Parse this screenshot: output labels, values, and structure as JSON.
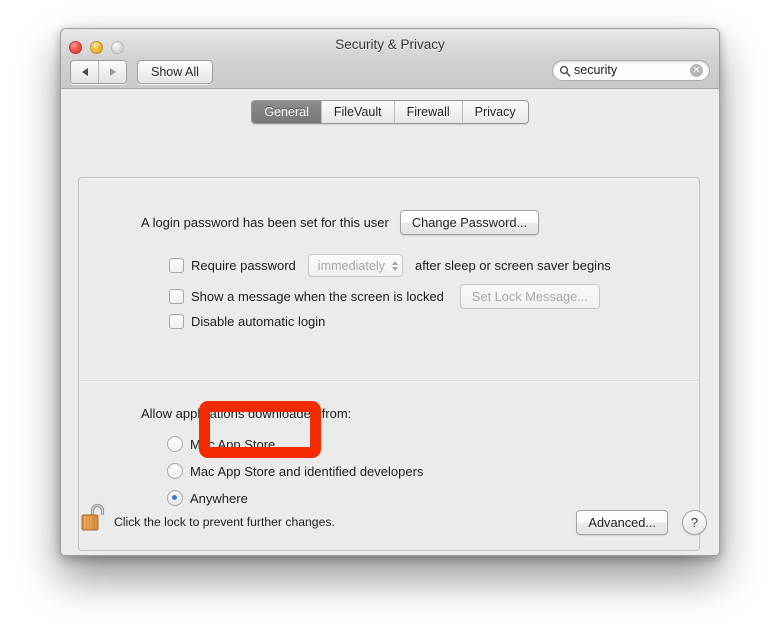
{
  "window": {
    "title": "Security & Privacy",
    "traffic_lights": [
      "close",
      "minimize",
      "zoom"
    ],
    "back_label": "back-arrow",
    "forward_label": "forward-arrow",
    "show_all_label": "Show All"
  },
  "search": {
    "value": "security",
    "icon": "search-icon",
    "clear_glyph": "✕"
  },
  "tabs": [
    {
      "label": "General",
      "active": true
    },
    {
      "label": "FileVault",
      "active": false
    },
    {
      "label": "Firewall",
      "active": false
    },
    {
      "label": "Privacy",
      "active": false
    }
  ],
  "general": {
    "password_status": "A login password has been set for this user",
    "change_password_button": "Change Password...",
    "checkboxes": [
      {
        "label": "Require password",
        "checked": false,
        "popup_value": "immediately",
        "popup_disabled": true,
        "suffix": "after sleep or screen saver begins"
      },
      {
        "label": "Show a message when the screen is locked",
        "checked": false,
        "button": "Set Lock Message...",
        "button_disabled": true
      },
      {
        "label": "Disable automatic login",
        "checked": false
      }
    ],
    "allow_label": "Allow applications downloaded from:",
    "radios": [
      {
        "label": "Mac App Store",
        "selected": false
      },
      {
        "label": "Mac App Store and identified developers",
        "selected": false
      },
      {
        "label": "Anywhere",
        "selected": true
      }
    ]
  },
  "annotation": {
    "target": "Anywhere",
    "color": "#f52b00"
  },
  "footer": {
    "lock_icon": "open-padlock-icon",
    "lock_text": "Click the lock to prevent further changes.",
    "advanced_button": "Advanced...",
    "help_button": "?"
  }
}
